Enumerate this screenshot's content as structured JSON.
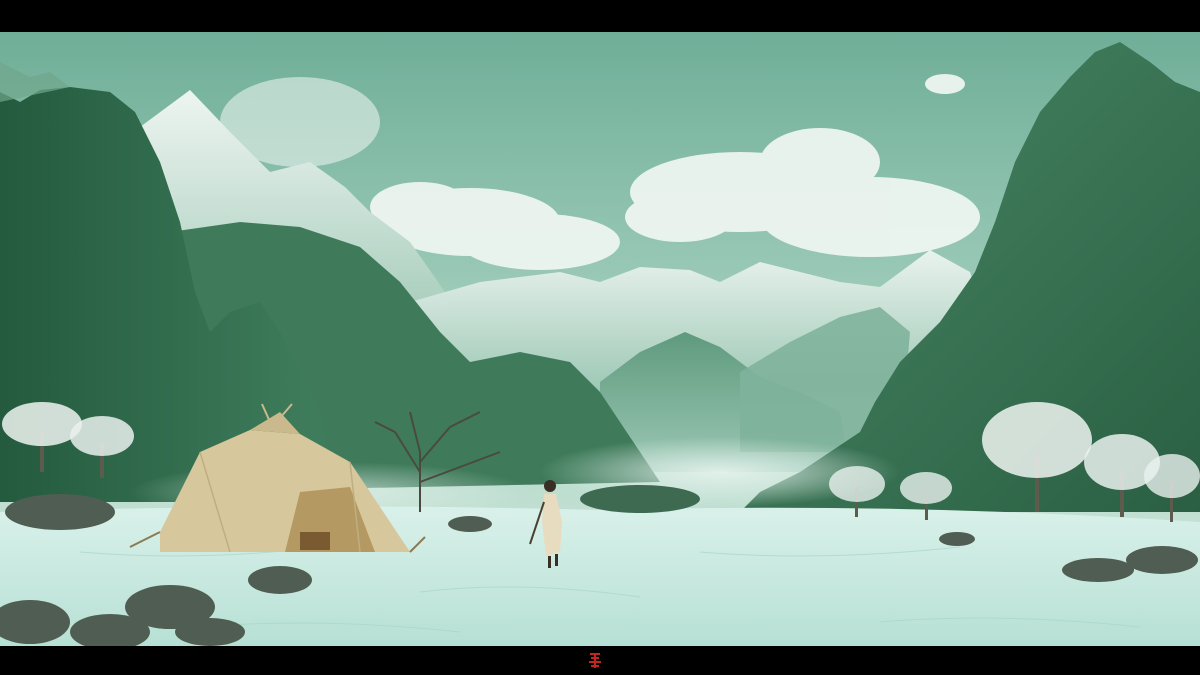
{
  "caption": "",
  "palette": {
    "sky_top": "#6fae98",
    "sky_bottom": "#c9e3d6",
    "mountain_dark": "#2f6a4c",
    "mountain_mid": "#4d8a6a",
    "snow": "#e4efe9",
    "ice": "#cfeee6",
    "tent": "#d6c79c",
    "seal_red": "#c3261f"
  }
}
